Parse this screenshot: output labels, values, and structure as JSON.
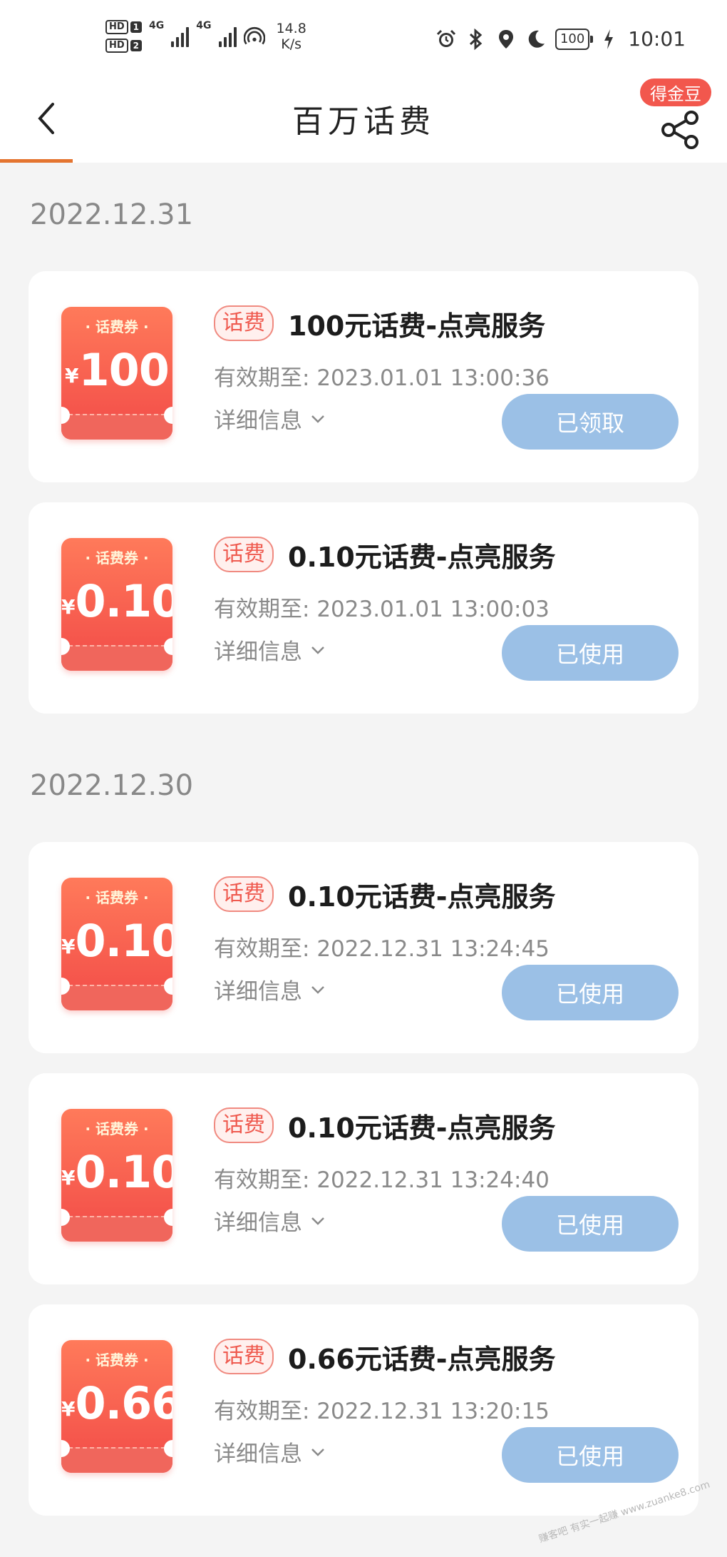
{
  "status_bar": {
    "sim1": "HD",
    "sim1_num": "1",
    "sim2": "HD",
    "sim2_num": "2",
    "net1": "4G",
    "net2": "4G",
    "speed_value": "14.8",
    "speed_unit": "K/s",
    "battery": "100",
    "time": "10:01"
  },
  "nav": {
    "title": "百万话费",
    "reward_badge": "得金豆"
  },
  "groups": [
    {
      "date": "2022.12.31",
      "items": [
        {
          "voucher_label": "· 话费券 ·",
          "currency": "¥",
          "amount": "100",
          "tag": "话费",
          "title": "100元话费-点亮服务",
          "valid_label": "有效期至:",
          "valid_until": "2023.01.01 13:00:36",
          "detail_label": "详细信息",
          "status": "已领取"
        },
        {
          "voucher_label": "· 话费券 ·",
          "currency": "¥",
          "amount": "0.10",
          "tag": "话费",
          "title": "0.10元话费-点亮服务",
          "valid_label": "有效期至:",
          "valid_until": "2023.01.01 13:00:03",
          "detail_label": "详细信息",
          "status": "已使用"
        }
      ]
    },
    {
      "date": "2022.12.30",
      "items": [
        {
          "voucher_label": "· 话费券 ·",
          "currency": "¥",
          "amount": "0.10",
          "tag": "话费",
          "title": "0.10元话费-点亮服务",
          "valid_label": "有效期至:",
          "valid_until": "2022.12.31 13:24:45",
          "detail_label": "详细信息",
          "status": "已使用"
        },
        {
          "voucher_label": "· 话费券 ·",
          "currency": "¥",
          "amount": "0.10",
          "tag": "话费",
          "title": "0.10元话费-点亮服务",
          "valid_label": "有效期至:",
          "valid_until": "2022.12.31 13:24:40",
          "detail_label": "详细信息",
          "status": "已使用"
        },
        {
          "voucher_label": "· 话费券 ·",
          "currency": "¥",
          "amount": "0.66",
          "tag": "话费",
          "title": "0.66元话费-点亮服务",
          "valid_label": "有效期至:",
          "valid_until": "2022.12.31 13:20:15",
          "detail_label": "详细信息",
          "status": "已使用"
        }
      ]
    }
  ],
  "watermark": "赚客吧 有实一起赚 www.zuanke8.com",
  "colors": {
    "accent": "#e4742f",
    "voucher_red": "#f24b48",
    "button_blue": "#9bc0e6",
    "badge_red": "#f2574d"
  }
}
